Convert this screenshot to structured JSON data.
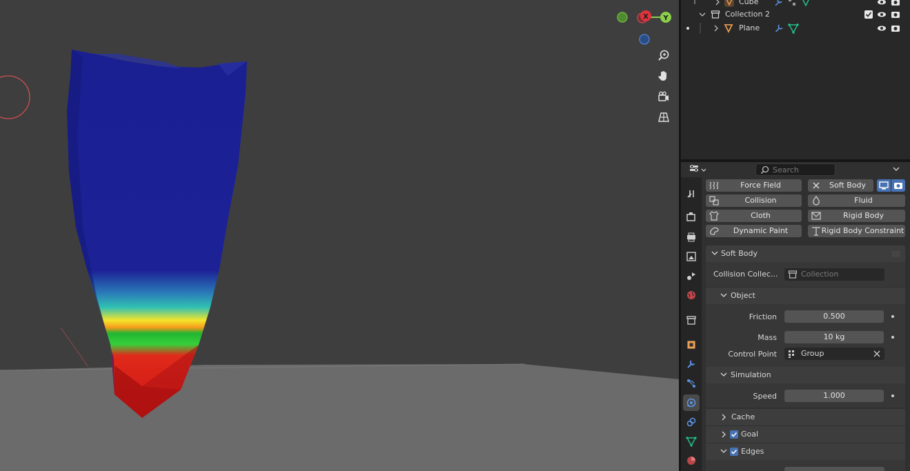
{
  "colors": {
    "viewport_bg": "#3e3e3e",
    "floor": "#6b6b6b",
    "panel_bg": "#303030",
    "accent": "#4772b3",
    "field": "#545454"
  },
  "outliner": {
    "rows": [
      {
        "label": "Cube",
        "icon": "mesh-object-icon"
      },
      {
        "label": "Collection 2",
        "icon": "collection-icon"
      },
      {
        "label": "Plane",
        "icon": "mesh-object-icon"
      }
    ]
  },
  "gizmo": {
    "x_label": "X",
    "y_label": "Y"
  },
  "properties": {
    "search_placeholder": "Search",
    "physics_buttons": [
      {
        "label": "Force Field",
        "icon": "force-field-icon"
      },
      {
        "label": "Soft Body",
        "icon": "remove-icon"
      },
      {
        "label": "Collision",
        "icon": "collision-icon"
      },
      {
        "label": "Fluid",
        "icon": "fluid-icon"
      },
      {
        "label": "Cloth",
        "icon": "cloth-icon"
      },
      {
        "label": "Rigid Body",
        "icon": "rigid-body-icon"
      },
      {
        "label": "Dynamic Paint",
        "icon": "dynamic-paint-icon"
      },
      {
        "label": "Rigid Body Constraint",
        "icon": "rigid-body-constraint-icon"
      }
    ],
    "soft_body": {
      "title": "Soft Body",
      "collision_collection_label": "Collision Collec...",
      "collision_collection_placeholder": "Collection",
      "object": {
        "title": "Object",
        "friction_label": "Friction",
        "friction_value": "0.500",
        "mass_label": "Mass",
        "mass_value": "10 kg",
        "control_point_label": "Control Point",
        "control_point_value": "Group"
      },
      "simulation": {
        "title": "Simulation",
        "speed_label": "Speed",
        "speed_value": "1.000"
      },
      "cache_title": "Cache",
      "goal_title": "Goal",
      "goal_checked": true,
      "edges_title": "Edges",
      "edges_checked": true
    }
  }
}
